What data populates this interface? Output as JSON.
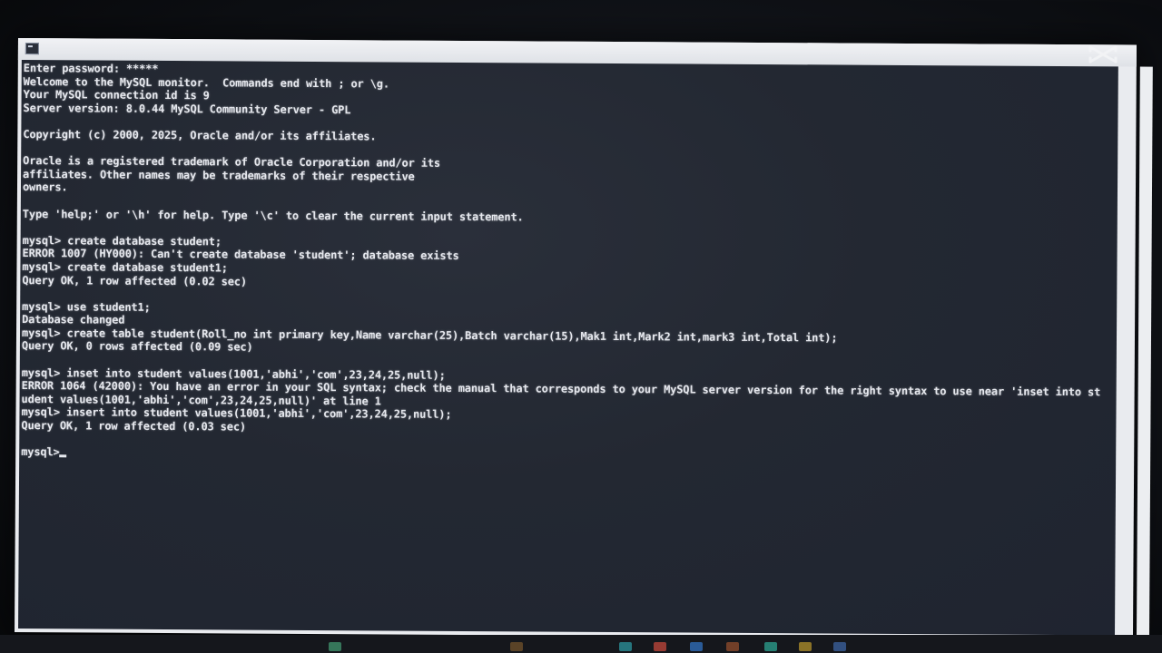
{
  "terminal": {
    "lines": [
      "Enter password: *****",
      "Welcome to the MySQL monitor.  Commands end with ; or \\g.",
      "Your MySQL connection id is 9",
      "Server version: 8.0.44 MySQL Community Server - GPL",
      "",
      "Copyright (c) 2000, 2025, Oracle and/or its affiliates.",
      "",
      "Oracle is a registered trademark of Oracle Corporation and/or its",
      "affiliates. Other names may be trademarks of their respective",
      "owners.",
      "",
      "Type 'help;' or '\\h' for help. Type '\\c' to clear the current input statement.",
      "",
      "mysql> create database student;",
      "ERROR 1007 (HY000): Can't create database 'student'; database exists",
      "mysql> create database student1;",
      "Query OK, 1 row affected (0.02 sec)",
      "",
      "mysql> use student1;",
      "Database changed",
      "mysql> create table student(Roll_no int primary key,Name varchar(25),Batch varchar(15),Mak1 int,Mark2 int,mark3 int,Total int);",
      "Query OK, 0 rows affected (0.09 sec)",
      "",
      "mysql> inset into student values(1001,'abhi','com',23,24,25,null);",
      "ERROR 1064 (42000): You have an error in your SQL syntax; check the manual that corresponds to your MySQL server version for the right syntax to use near 'inset into st",
      "udent values(1001,'abhi','com',23,24,25,null)' at line 1",
      "mysql> insert into student values(1001,'abhi','com',23,24,25,null);",
      "Query OK, 1 row affected (0.03 sec)",
      ""
    ],
    "prompt": "mysql>"
  },
  "icons": {
    "window": "command-prompt-icon",
    "brand": "capcut-logo-icon"
  },
  "colors": {
    "terminal_bg": "#232832",
    "terminal_fg": "#e6e8ee",
    "bezel": "#e9ebef"
  }
}
